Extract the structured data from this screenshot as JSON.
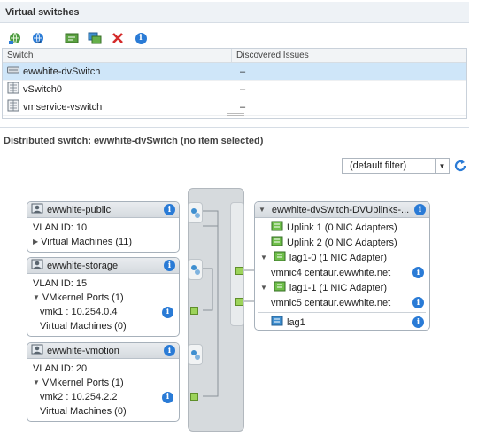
{
  "virtual_switches": {
    "title": "Virtual switches",
    "toolbar": [
      {
        "icon": "add-network-icon"
      },
      {
        "icon": "refresh-network-icon"
      },
      {
        "icon": "edit-settings-icon"
      },
      {
        "icon": "migrate-icon"
      },
      {
        "icon": "remove-icon"
      },
      {
        "icon": "info-icon"
      }
    ],
    "columns": [
      "Switch",
      "Discovered Issues"
    ],
    "rows": [
      {
        "name": "ewwhite-dvSwitch",
        "issues": "–",
        "selected": true,
        "icon": "distributed-switch-icon"
      },
      {
        "name": "vSwitch0",
        "issues": "–",
        "selected": false,
        "icon": "standard-switch-icon"
      },
      {
        "name": "vmservice-vswitch",
        "issues": "–",
        "selected": false,
        "icon": "standard-switch-icon"
      }
    ]
  },
  "distributed": {
    "title": "Distributed switch: ewwhite-dvSwitch (no item selected)",
    "filter": "(default filter)"
  },
  "portgroups": [
    {
      "name": "ewwhite-public",
      "vlan": "VLAN ID: 10",
      "vm_label": "Virtual Machines (11)"
    },
    {
      "name": "ewwhite-storage",
      "vlan": "VLAN ID: 15",
      "vmk_label": "VMkernel Ports (1)",
      "vmk_item": "vmk1 : 10.254.0.4",
      "vm_label": "Virtual Machines (0)"
    },
    {
      "name": "ewwhite-vmotion",
      "vlan": "VLAN ID: 20",
      "vmk_label": "VMkernel Ports (1)",
      "vmk_item": "vmk2 : 10.254.2.2",
      "vm_label": "Virtual Machines (0)"
    }
  ],
  "uplinks": {
    "name": "ewwhite-dvSwitch-DVUplinks-...",
    "items": [
      {
        "label": "Uplink 1 (0 NIC Adapters)"
      },
      {
        "label": "Uplink 2 (0 NIC Adapters)"
      },
      {
        "label": "lag1-0 (1 NIC Adapter)",
        "nic": "vmnic4 centaur.ewwhite.net"
      },
      {
        "label": "lag1-1 (1 NIC Adapter)",
        "nic": "vmnic5 centaur.ewwhite.net"
      }
    ],
    "lag": "lag1"
  },
  "colors": {
    "selected_row": "#cfe6f9",
    "port_green": "#9cd35a",
    "info_blue": "#2a7bd6",
    "header_bg": "#eef2f6"
  }
}
